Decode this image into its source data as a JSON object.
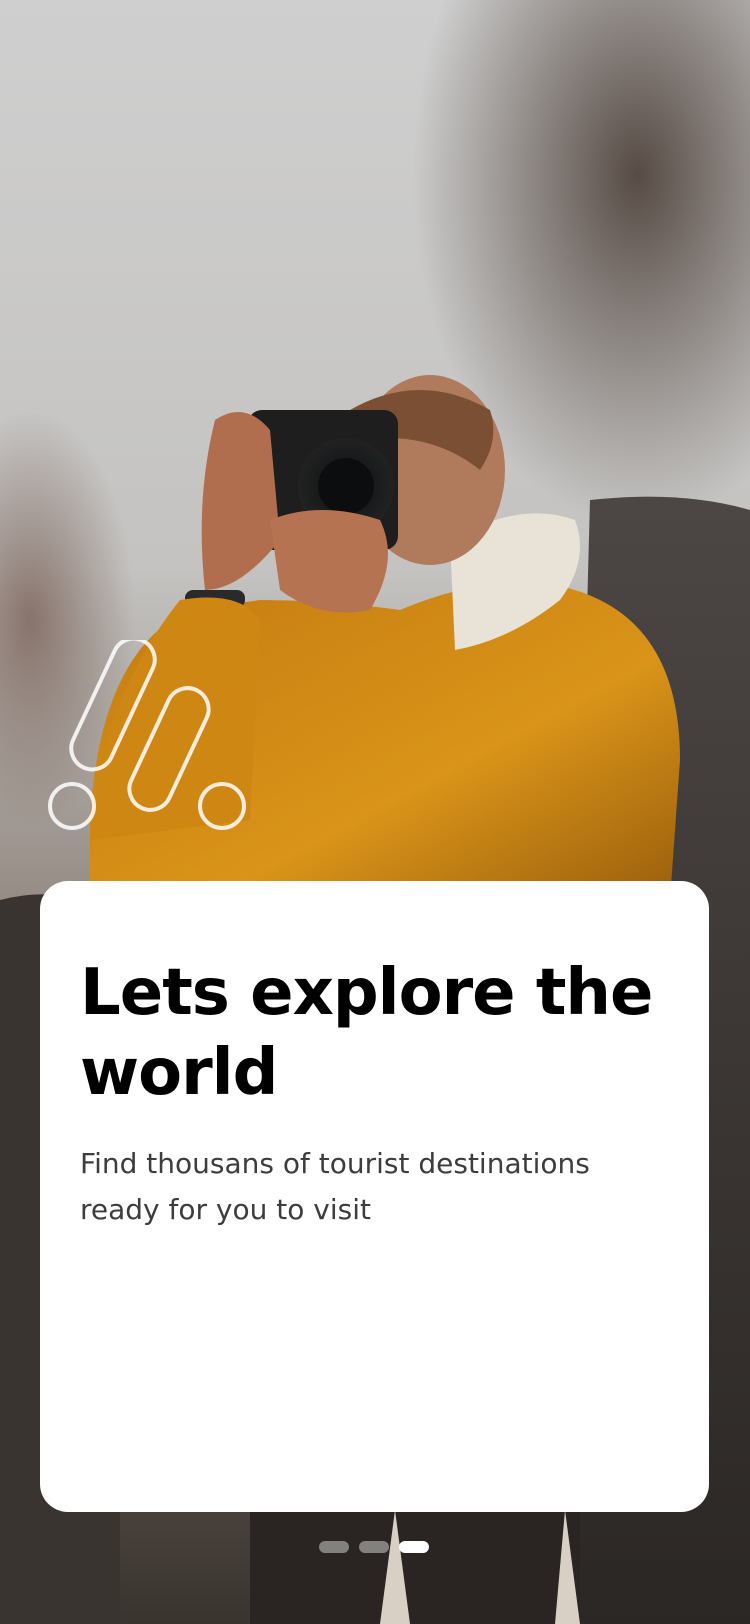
{
  "onboarding": {
    "title": "Lets explore the world",
    "subtitle": "Find thousans of tourist destinations ready for you to visit",
    "pager": {
      "total": 3,
      "active_index": 2
    }
  },
  "background": {
    "subject": "photographer in mustard jacket holding camera",
    "sky_color": "#c9c8c6",
    "jacket_color": "#d38a14"
  },
  "icons": {
    "logo": "wave-pill-logo-icon"
  }
}
